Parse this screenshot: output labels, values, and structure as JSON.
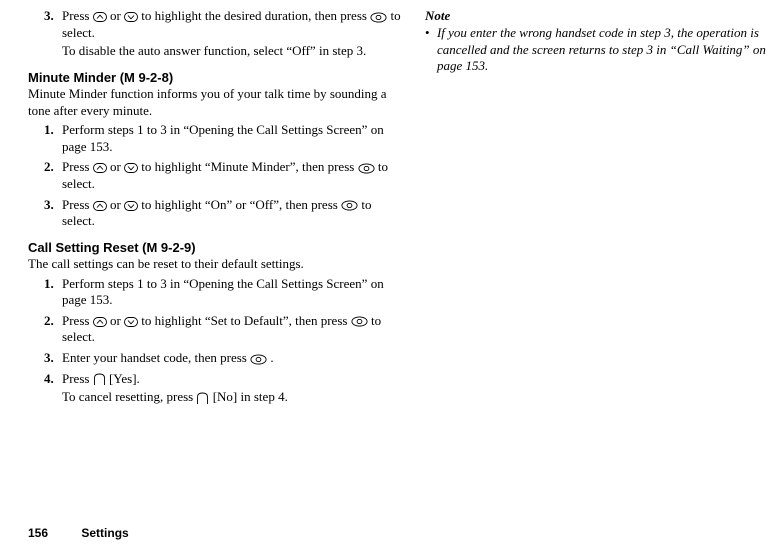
{
  "left": {
    "top_step3": {
      "num": "3.",
      "text_before": "Press ",
      "text_mid1": " or ",
      "text_mid2": " to highlight the desired duration, then press ",
      "text_after": " to select.",
      "followup": "To disable the auto answer function, select “Off” in step 3."
    },
    "minute": {
      "heading": "Minute Minder (M 9-2-8)",
      "intro": "Minute Minder function informs you of your talk time by sounding a tone after every minute.",
      "s1": {
        "num": "1.",
        "text": "Perform steps 1 to 3 in “Opening the Call Settings Screen” on page 153."
      },
      "s2": {
        "num": "2.",
        "pre": "Press ",
        "mid1": " or ",
        "mid2": " to highlight “Minute Minder”, then press ",
        "post": " to select."
      },
      "s3": {
        "num": "3.",
        "pre": "Press ",
        "mid1": " or ",
        "mid2": " to highlight “On” or “Off”, then press ",
        "post": " to select."
      }
    },
    "reset": {
      "heading": "Call Setting Reset (M 9-2-9)",
      "intro": "The call settings can be reset to their default settings.",
      "s1": {
        "num": "1.",
        "text": "Perform steps 1 to 3 in “Opening the Call Settings Screen” on page 153."
      },
      "s2": {
        "num": "2.",
        "pre": "Press ",
        "mid1": " or ",
        "mid2": " to highlight “Set to Default”, then press ",
        "post": " to select."
      },
      "s3": {
        "num": "3.",
        "pre": "Enter your handset code, then press ",
        "post": "."
      },
      "s4": {
        "num": "4.",
        "pre": "Press ",
        "mid": " [Yes].",
        "follow_pre": "To cancel resetting, press ",
        "follow_post": " [No] in step 4."
      }
    }
  },
  "right": {
    "note_head": "Note",
    "note_text": "If you enter the wrong handset code in step 3, the operation is cancelled and the screen returns to step 3 in “Call Waiting” on page 153."
  },
  "footer": {
    "page": "156",
    "section": "Settings"
  }
}
